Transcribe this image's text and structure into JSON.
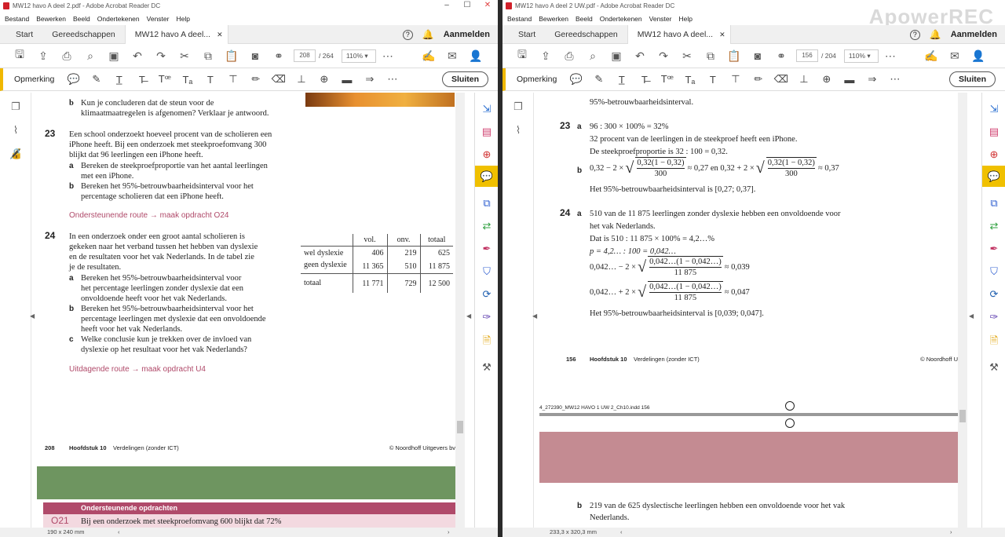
{
  "left": {
    "title": "MW12 havo A deel 2.pdf - Adobe Acrobat Reader DC",
    "menu": [
      "Bestand",
      "Bewerken",
      "Beeld",
      "Ondertekenen",
      "Venster",
      "Help"
    ],
    "tabs": {
      "start": "Start",
      "tools": "Gereedschappen",
      "doc": "MW12 havo A deel..."
    },
    "login": "Aanmelden",
    "page_current": "208",
    "page_total": "/ 264",
    "zoom": "110%",
    "comment_label": "Opmerking",
    "close_label": "Sluiten",
    "content": {
      "b_prev": "Kun je concluderen dat de steun voor de",
      "b_prev2": "klimaatmaatregelen is afgenomen? Verklaar je antwoord.",
      "q23_num": "23",
      "q23_l1": "Een school onderzoekt hoeveel procent van de scholieren een",
      "q23_l2": "iPhone heeft. Bij een onderzoek met steekproefomvang 300",
      "q23_l3": "blijkt dat 96 leerlingen een iPhone heeft.",
      "q23a_1": "Bereken de steekproefproportie van het aantal leerlingen",
      "q23a_2": "met een iPhone.",
      "q23b_1": "Bereken het 95%-betrouwbaarheidsinterval voor het",
      "q23b_2": "percentage scholieren dat een iPhone heeft.",
      "route1": "Ondersteunende route → maak opdracht O24",
      "q24_num": "24",
      "q24_l1": "In een onderzoek onder een groot aantal scholieren is",
      "q24_l2": "gekeken naar het verband tussen het hebben van dyslexie",
      "q24_l3": "en de resultaten voor het vak Nederlands. In de tabel zie",
      "q24_l4": "je de resultaten.",
      "q24a_1": "Bereken het 95%-betrouwbaarheidsinterval voor",
      "q24a_2": "het percentage leerlingen zonder dyslexie dat een",
      "q24a_3": "onvoldoende heeft voor het vak Nederlands.",
      "q24b_1": "Bereken het 95%-betrouwbaarheidsinterval voor het",
      "q24b_2": "percentage leerlingen met dyslexie dat een onvoldoende",
      "q24b_3": "heeft voor het vak Nederlands.",
      "q24c_1": "Welke conclusie kun je trekken over de invloed van",
      "q24c_2": "dyslexie op het resultaat voor het vak Nederlands?",
      "route2": "Uitdagende route → maak opdracht U4",
      "table": {
        "headers": [
          "",
          "vol.",
          "onv.",
          "totaal"
        ],
        "rows": [
          [
            "wel dyslexie",
            "406",
            "219",
            "625"
          ],
          [
            "geen dyslexie",
            "11 365",
            "510",
            "11 875"
          ],
          [
            "totaal",
            "11 771",
            "729",
            "12 500"
          ]
        ]
      },
      "footer_page": "208",
      "footer_ch": "Hoofdstuk 10",
      "footer_title": "Verdelingen (zonder ICT)",
      "footer_pub": "© Noordhoff Uitgevers bv",
      "next_header": "Ondersteunende opdrachten",
      "next_num": "O21",
      "next_text": "Bij een onderzoek met steekproefomvang 600 blijkt dat 72%"
    },
    "status": "190 x 240 mm"
  },
  "right": {
    "title": "MW12 havo A deel 2 UW.pdf - Adobe Acrobat Reader DC",
    "menu": [
      "Bestand",
      "Bewerken",
      "Beeld",
      "Ondertekenen",
      "Venster",
      "Help"
    ],
    "tabs": {
      "start": "Start",
      "tools": "Gereedschappen",
      "doc": "MW12 havo A deel..."
    },
    "login": "Aanmelden",
    "page_current": "156",
    "page_total": "/ 204",
    "zoom": "110%",
    "comment_label": "Opmerking",
    "close_label": "Sluiten",
    "watermark": "ApowerREC",
    "content": {
      "prev": "95%-betrouwbaarheidsinterval.",
      "a23_num": "23",
      "a23a": "96 : 300 × 100% = 32%",
      "a23a_2": "32 procent van de leerlingen in de steekproef heeft een iPhone.",
      "a23a_3": "De steekproefproportie is 32 : 100 = 0,32.",
      "a23b_pre": "0,32 − 2 ×",
      "a23b_num": "0,32(1 − 0,32)",
      "a23b_den": "300",
      "a23b_mid": "≈ 0,27 en 0,32 + 2 ×",
      "a23b_end": "≈ 0,37",
      "a23b_2": "Het 95%-betrouwbaarheidsinterval is [0,27; 0,37].",
      "a24_num": "24",
      "a24a_1": "510 van de 11 875 leerlingen zonder dyslexie hebben een onvoldoende voor",
      "a24a_2": "het vak Nederlands.",
      "a24a_3": "Dat is 510 : 11 875 × 100% = 4,2…%",
      "a24a_4": "p = 4,2… : 100 = 0,042…",
      "a24a_5pre": "0,042… − 2 ×",
      "a24a_num": "0,042…(1 − 0,042…)",
      "a24a_den": "11 875",
      "a24a_5end": "≈ 0,039",
      "a24a_6pre": "0,042… + 2 ×",
      "a24a_6end": "≈ 0,047",
      "a24a_7": "Het 95%-betrouwbaarheidsinterval is [0,039; 0,047].",
      "footer_page": "156",
      "footer_ch": "Hoofdstuk 10",
      "footer_title": "Verdelingen (zonder ICT)",
      "footer_pub": "© Noordhoff U",
      "slug": "4_272390_MW12 HAVO 1 UW 2_Ch10.indd  156",
      "b_1": "219 van de 625 dyslectische leerlingen hebben een onvoldoende voor het vak",
      "b_2": "Nederlands."
    },
    "status": "233,3 x 320,3 mm"
  }
}
